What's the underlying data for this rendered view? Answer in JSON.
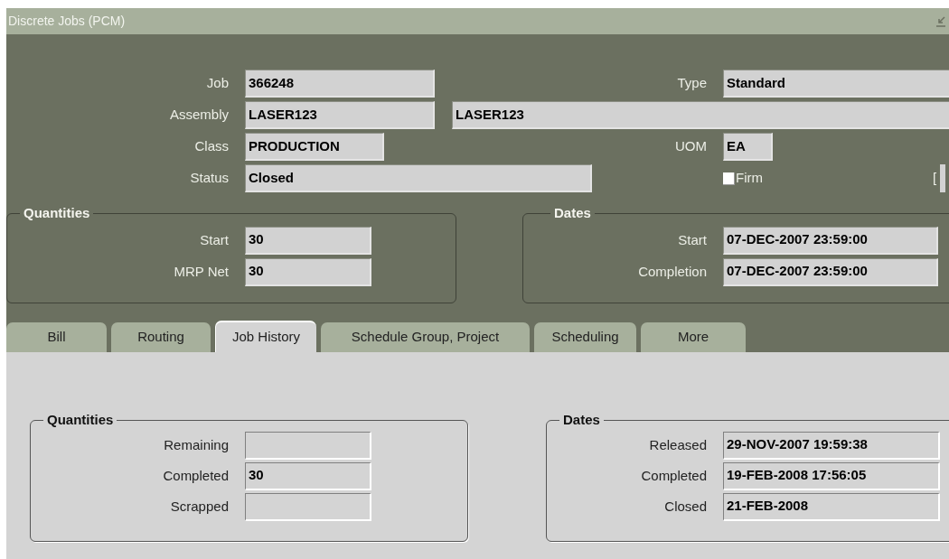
{
  "window": {
    "title": "Discrete Jobs (PCM)"
  },
  "header": {
    "job": {
      "label": "Job",
      "value": "366248"
    },
    "type": {
      "label": "Type",
      "value": "Standard"
    },
    "assembly": {
      "label": "Assembly",
      "value": "LASER123",
      "description": "LASER123"
    },
    "class": {
      "label": "Class",
      "value": "PRODUCTION"
    },
    "uom": {
      "label": "UOM",
      "value": "EA"
    },
    "status": {
      "label": "Status",
      "value": "Closed"
    },
    "firm": {
      "label": "Firm",
      "checked": false
    },
    "bracket": "["
  },
  "quantities": {
    "title": "Quantities",
    "fields": [
      {
        "label": "Start",
        "value": "30"
      },
      {
        "label": "MRP Net",
        "value": "30"
      }
    ]
  },
  "dates": {
    "title": "Dates",
    "fields": [
      {
        "label": "Start",
        "value": "07-DEC-2007 23:59:00"
      },
      {
        "label": "Completion",
        "value": "07-DEC-2007 23:59:00"
      }
    ]
  },
  "tabs": [
    {
      "label": "Bill",
      "selected": false
    },
    {
      "label": "Routing",
      "selected": false
    },
    {
      "label": "Job History",
      "selected": true
    },
    {
      "label": "Schedule Group, Project",
      "selected": false
    },
    {
      "label": "Scheduling",
      "selected": false
    },
    {
      "label": "More",
      "selected": false
    }
  ],
  "job_history": {
    "quantities": {
      "title": "Quantities",
      "fields": [
        {
          "label": "Remaining"
        },
        {
          "label": "Completed",
          "value": "30"
        },
        {
          "label": "Scrapped"
        }
      ]
    },
    "dates": {
      "title": "Dates",
      "fields": [
        {
          "label": "Released",
          "value": "29-NOV-2007 19:59:38"
        },
        {
          "label": "Completed",
          "value": "19-FEB-2008 17:56:05"
        },
        {
          "label": "Closed",
          "value": "21-FEB-2008"
        }
      ]
    }
  }
}
